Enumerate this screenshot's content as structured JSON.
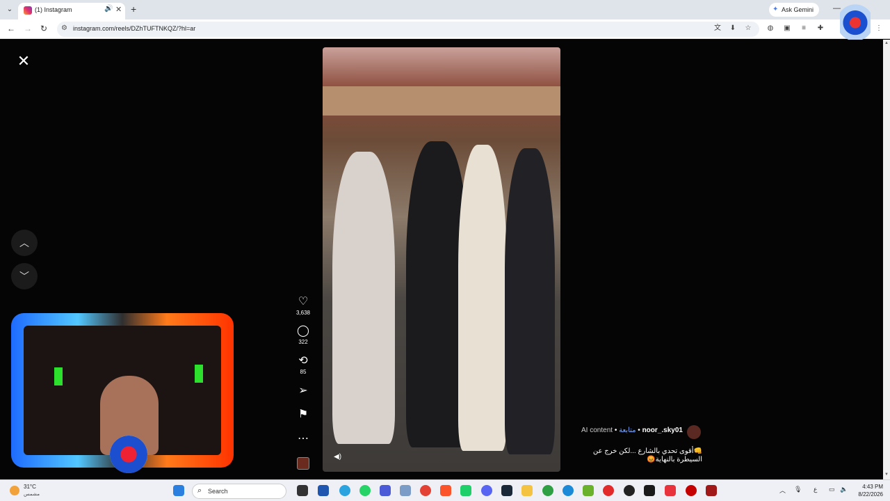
{
  "browser": {
    "tab_title": "(1) Instagram",
    "ask_gemini": "Ask Gemini",
    "url": "instagram.com/reels/DZhTUFTNKQZ/?hl=ar"
  },
  "reel": {
    "likes": "3,638",
    "comments": "322",
    "reposts": "85",
    "username": "noor_.sky01",
    "follow_label": "متابعة",
    "ai_label": "AI content",
    "caption_line1": "👊أقوى تحدي بالشارع ...لكن خرج عن",
    "caption_line2": "السيطرة بالنهاية😡"
  },
  "icons": {
    "close": "close-icon",
    "up": "chevron-up-icon",
    "down": "chevron-down-icon",
    "like": "heart-icon",
    "comment": "comment-icon",
    "repost": "repost-icon",
    "share": "send-icon",
    "save": "bookmark-icon",
    "more": "more-icon",
    "mute": "speaker-icon"
  },
  "taskbar": {
    "temperature": "31°C",
    "condition": "مشمس",
    "search_label": "Search",
    "time": "4:43 PM",
    "date": "8/22/2026",
    "ime": "ع"
  }
}
